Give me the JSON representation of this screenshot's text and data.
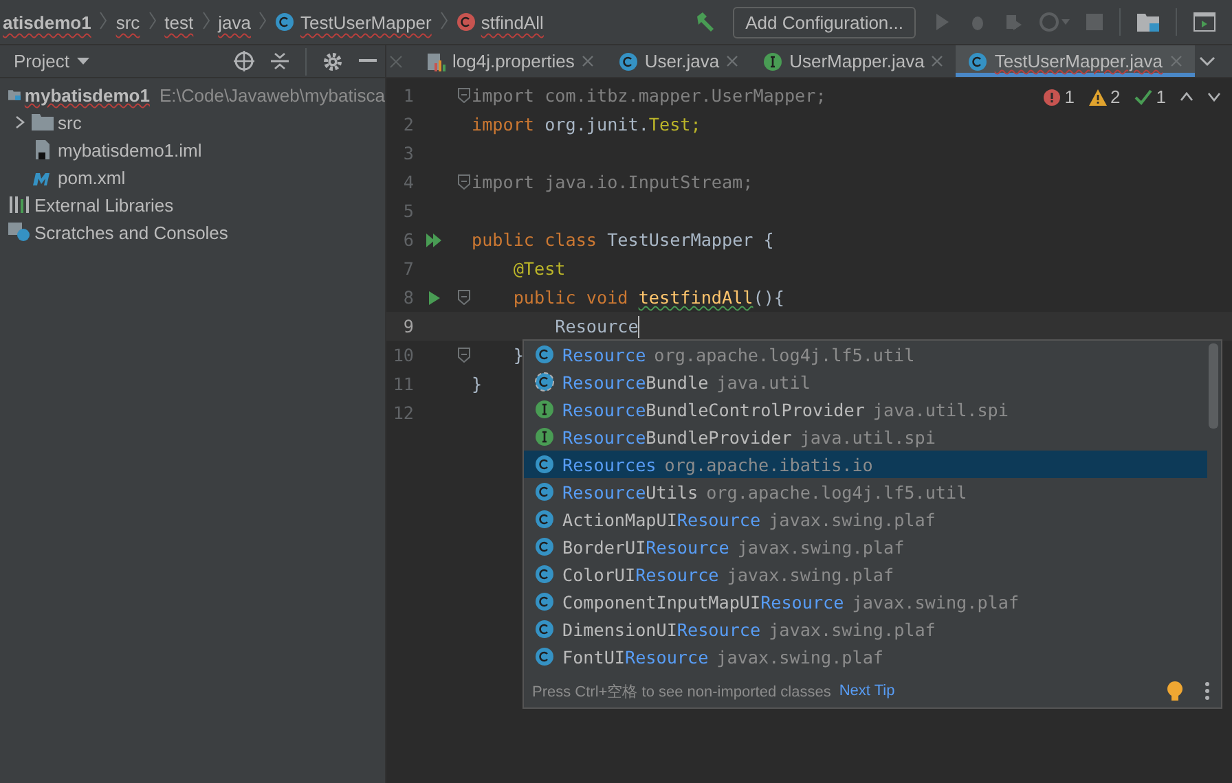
{
  "breadcrumbs": [
    {
      "label": "atisdemo1",
      "kind": "module"
    },
    {
      "label": "src",
      "kind": "folder"
    },
    {
      "label": "test",
      "kind": "folder"
    },
    {
      "label": "java",
      "kind": "folder"
    },
    {
      "label": "TestUserMapper",
      "kind": "class"
    },
    {
      "label": "stfindAll",
      "kind": "method"
    }
  ],
  "toolbar": {
    "config_button": "Add Configuration..."
  },
  "project": {
    "title": "Project",
    "tree": [
      {
        "label": "mybatisdemo1",
        "path": "E:\\Code\\Javaweb\\mybatisca",
        "kind": "module",
        "children": [
          {
            "label": "src",
            "kind": "folder",
            "expanded": false
          },
          {
            "label": "mybatisdemo1.iml",
            "kind": "file"
          },
          {
            "label": "pom.xml",
            "kind": "maven"
          }
        ]
      },
      {
        "label": "External Libraries",
        "kind": "library"
      },
      {
        "label": "Scratches and Consoles",
        "kind": "scratch"
      }
    ]
  },
  "tabs": [
    {
      "label": "log4j.properties",
      "kind": "props",
      "selected": false
    },
    {
      "label": "User.java",
      "kind": "class",
      "selected": false
    },
    {
      "label": "UserMapper.java",
      "kind": "interface",
      "selected": false
    },
    {
      "label": "TestUserMapper.java",
      "kind": "class",
      "selected": true
    }
  ],
  "inspections": {
    "errors": "1",
    "warnings": "2",
    "typos": "1"
  },
  "editor": {
    "lines": [
      {
        "number": "1",
        "fold": true,
        "current": false,
        "kind": "plain",
        "tokens": [
          {
            "text": "import com.itbz.mapper.UserMapper;",
            "kind": "unused"
          }
        ]
      },
      {
        "number": "2",
        "fold": false,
        "current": false,
        "kind": "plain",
        "tokens": [
          {
            "text": "import",
            "kind": "keyword"
          },
          {
            "text": " org.junit.",
            "kind": "plain"
          },
          {
            "text": "Test;",
            "kind": "annotation"
          }
        ]
      },
      {
        "number": "3",
        "fold": false,
        "current": false,
        "kind": "plain"
      },
      {
        "number": "4",
        "fold": true,
        "current": false,
        "kind": "plain",
        "tokens": [
          {
            "text": "import java.io.InputStream;",
            "kind": "unused"
          }
        ]
      },
      {
        "number": "5",
        "fold": false,
        "current": false,
        "kind": "plain"
      },
      {
        "number": "6",
        "fold": false,
        "current": false,
        "kind": "run-all",
        "tokens": [
          {
            "text": "public class ",
            "kind": "keyword"
          },
          {
            "text": "TestUserMapper {",
            "kind": "plain"
          }
        ]
      },
      {
        "number": "7",
        "fold": false,
        "current": false,
        "kind": "plain",
        "tokens": [
          {
            "text": "    @Test",
            "kind": "annotation"
          }
        ]
      },
      {
        "number": "8",
        "fold": true,
        "current": false,
        "kind": "run",
        "tokens": [
          {
            "text": "    public void ",
            "kind": "keyword"
          },
          {
            "text": "testfindAll",
            "kind": "method"
          },
          {
            "text": "(){",
            "kind": "plain"
          }
        ]
      },
      {
        "number": "9",
        "fold": false,
        "current": true,
        "kind": "plain",
        "tokens": [
          {
            "text": "        Resource",
            "kind": "plain"
          }
        ]
      },
      {
        "number": "10",
        "fold": true,
        "current": false,
        "kind": "plain",
        "tokens": [
          {
            "text": "    }",
            "kind": "plain"
          }
        ]
      },
      {
        "number": "11",
        "fold": false,
        "current": false,
        "kind": "plain",
        "tokens": [
          {
            "text": "}",
            "kind": "plain"
          }
        ]
      },
      {
        "number": "12",
        "fold": false,
        "current": false,
        "kind": "plain"
      }
    ]
  },
  "completion": {
    "items": [
      {
        "kind": "class",
        "match": "Resource",
        "package": "org.apache.log4j.lf5.util",
        "selected": false
      },
      {
        "kind": "abstract",
        "match": "Resource",
        "after": "Bundle",
        "package": "java.util",
        "selected": false
      },
      {
        "kind": "interface",
        "match": "Resource",
        "after": "BundleControlProvider",
        "package": "java.util.spi",
        "selected": false
      },
      {
        "kind": "interface",
        "match": "Resource",
        "after": "BundleProvider",
        "package": "java.util.spi",
        "selected": false
      },
      {
        "kind": "class",
        "match": "Resources",
        "package": "org.apache.ibatis.io",
        "selected": true
      },
      {
        "kind": "class",
        "match": "Resource",
        "after": "Utils",
        "package": "org.apache.log4j.lf5.util",
        "selected": false
      },
      {
        "kind": "class",
        "before": "ActionMapUI",
        "match": "Resource",
        "package": "javax.swing.plaf",
        "selected": false
      },
      {
        "kind": "class",
        "before": "BorderUI",
        "match": "Resource",
        "package": "javax.swing.plaf",
        "selected": false
      },
      {
        "kind": "class",
        "before": "ColorUI",
        "match": "Resource",
        "package": "javax.swing.plaf",
        "selected": false
      },
      {
        "kind": "class",
        "before": "ComponentInputMapUI",
        "match": "Resource",
        "package": "javax.swing.plaf",
        "selected": false
      },
      {
        "kind": "class",
        "before": "DimensionUI",
        "match": "Resource",
        "package": "javax.swing.plaf",
        "selected": false
      },
      {
        "kind": "class",
        "before": "FontUI",
        "match": "Resource",
        "package": "javax.swing.plaf",
        "selected": false
      }
    ],
    "hint": "Press Ctrl+空格 to see non-imported classes",
    "next_tip": "Next Tip"
  }
}
